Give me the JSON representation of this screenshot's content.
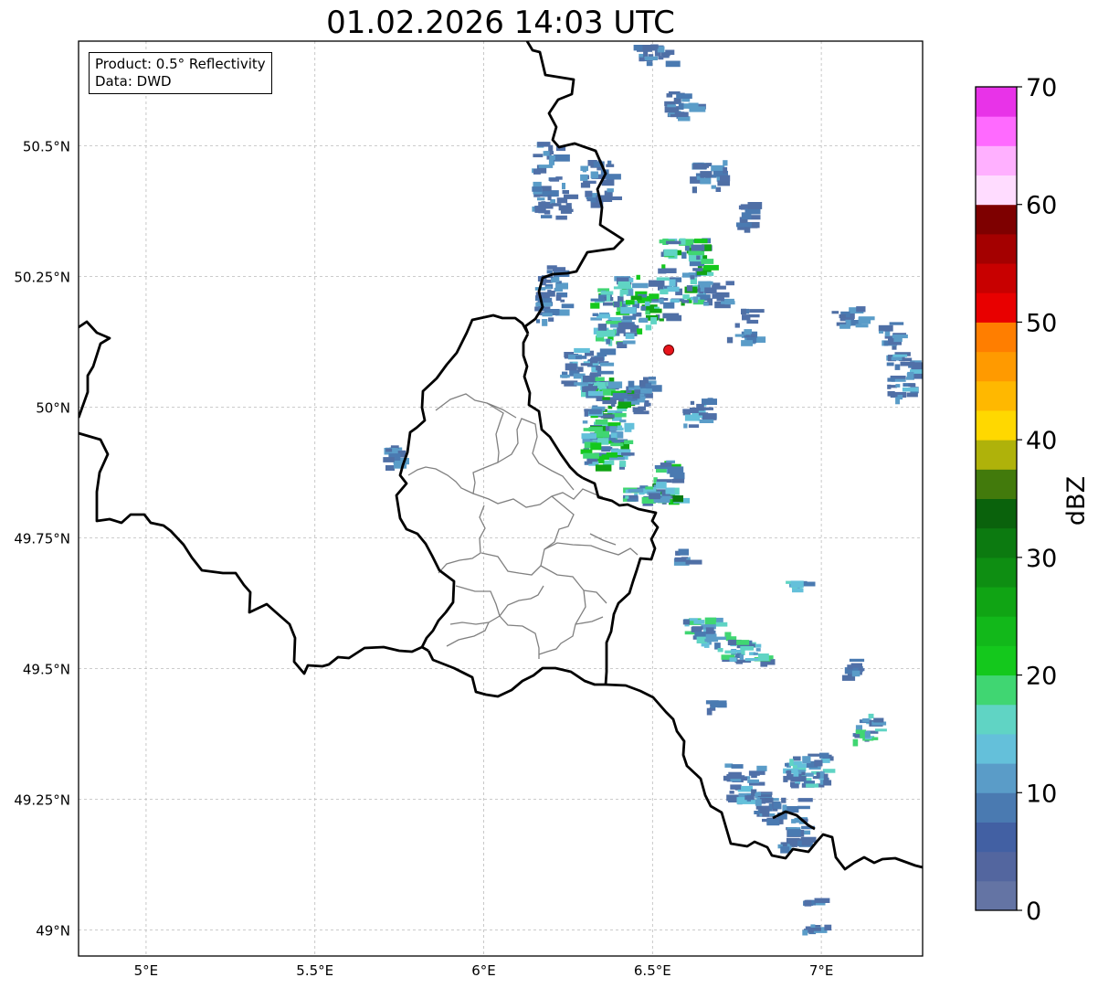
{
  "title": "01.02.2026 14:03 UTC",
  "info_box": {
    "product": "Product: 0.5° Reflectivity",
    "data": "Data: DWD"
  },
  "map": {
    "lon_range": [
      4.8,
      7.3
    ],
    "lat_range": [
      48.95,
      50.7
    ],
    "lon_ticks": [
      {
        "value": 5.0,
        "label": "5°E"
      },
      {
        "value": 5.5,
        "label": "5.5°E"
      },
      {
        "value": 6.0,
        "label": "6°E"
      },
      {
        "value": 6.5,
        "label": "6.5°E"
      },
      {
        "value": 7.0,
        "label": "7°E"
      }
    ],
    "lat_ticks": [
      {
        "value": 49.0,
        "label": "49°N"
      },
      {
        "value": 49.25,
        "label": "49.25°N"
      },
      {
        "value": 49.5,
        "label": "49.5°N"
      },
      {
        "value": 49.75,
        "label": "49.75°N"
      },
      {
        "value": 50.0,
        "label": "50°N"
      },
      {
        "value": 50.25,
        "label": "50.25°N"
      },
      {
        "value": 50.5,
        "label": "50.5°N"
      }
    ],
    "gridlines": "dashed, light grey",
    "radar_site": {
      "lon": 6.548,
      "lat": 50.109,
      "color": "#e8141b"
    }
  },
  "colorbar": {
    "label": "dBZ",
    "min": 0,
    "max": 70,
    "step": 2.5,
    "ticks": [
      "0",
      "10",
      "20",
      "30",
      "40",
      "50",
      "60",
      "70"
    ],
    "colors": [
      "#6474a4",
      "#53669f",
      "#4260a3",
      "#4a7ab1",
      "#5a9cc8",
      "#64c0da",
      "#60d4c4",
      "#40d672",
      "#14c81c",
      "#12b81a",
      "#10a414",
      "#0e8e12",
      "#0c7a10",
      "#0a620c",
      "#427a0c",
      "#afb20a",
      "#ffd800",
      "#ffb800",
      "#ff9a00",
      "#ff7e00",
      "#e80000",
      "#c80000",
      "#a40000",
      "#7e0000",
      "#ffdcff",
      "#ffb0ff",
      "#ff6aff",
      "#e833e8"
    ]
  }
}
